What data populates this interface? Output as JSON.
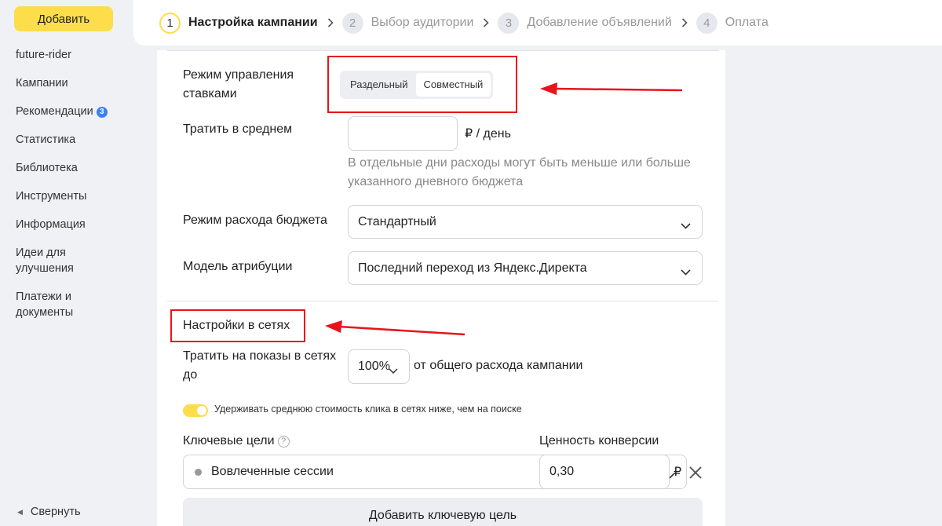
{
  "sidebar": {
    "add_button": "Добавить",
    "items": [
      {
        "label": "future-rider"
      },
      {
        "label": "Кампании"
      },
      {
        "label": "Рекомендации",
        "badge": "3"
      },
      {
        "label": "Статистика"
      },
      {
        "label": "Библиотека"
      },
      {
        "label": "Инструменты"
      },
      {
        "label": "Информация"
      },
      {
        "label": "Идеи для улучшения"
      },
      {
        "label": "Платежи и документы"
      }
    ],
    "collapse": "Свернуть"
  },
  "stepper": {
    "steps": [
      {
        "num": "1",
        "label": "Настройка кампании",
        "active": true
      },
      {
        "num": "2",
        "label": "Выбор аудитории"
      },
      {
        "num": "3",
        "label": "Добавление объявлений"
      },
      {
        "num": "4",
        "label": "Оплата"
      }
    ]
  },
  "form": {
    "bid_mode": {
      "label": "Режим управления ставками",
      "options": [
        "Раздельный",
        "Совместный"
      ],
      "selected": "Совместный"
    },
    "spend": {
      "label": "Тратить в среднем",
      "value": "",
      "suffix": "₽ / день",
      "hint": "В отдельные дни расходы могут быть меньше или больше указанного дневного бюджета"
    },
    "budget_mode": {
      "label": "Режим расхода бюджета",
      "value": "Стандартный"
    },
    "attribution": {
      "label": "Модель атрибуции",
      "value": "Последний переход из Яндекс.Директа"
    }
  },
  "network": {
    "title": "Настройки в сетях",
    "spend_label": "Тратить на показы в сетях до",
    "spend_value": "100%",
    "spend_suffix": "от общего расхода кампании",
    "toggle_label": "Удерживать среднюю стоимость клика в сетях ниже, чем на поиске",
    "toggle_on": true,
    "goals_label": "Ключевые цели",
    "goal_value": "Вовлеченные сессии",
    "conversion_label": "Ценность конверсии",
    "conversion_value": "0,30",
    "currency": "₽",
    "add_goal_button": "Добавить ключевую цель"
  },
  "colors": {
    "accent_yellow": "#fddd4a",
    "annotation_red": "#e8141b",
    "badge_blue": "#3a80f5"
  }
}
